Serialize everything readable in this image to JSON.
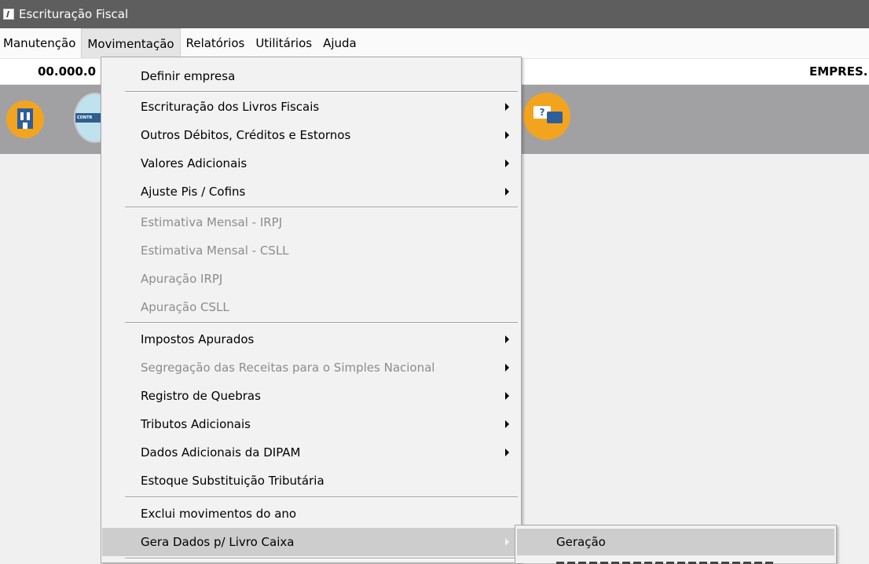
{
  "window": {
    "title": "Escrituração Fiscal",
    "icon": "app-icon"
  },
  "menubar": {
    "items": [
      {
        "label": "Manutenção"
      },
      {
        "label": "Movimentação",
        "active": true
      },
      {
        "label": "Relatórios"
      },
      {
        "label": "Utilitários"
      },
      {
        "label": "Ajuda"
      }
    ]
  },
  "infobar": {
    "left_text": "00.000.0",
    "right_text": "EMPRES."
  },
  "toolbar": {
    "icons": [
      "building-icon",
      "control-icon",
      "help-chat-icon"
    ],
    "control_label": "CONTR",
    "help_mark": "?"
  },
  "dropdown": {
    "items": [
      {
        "label": "Definir empresa",
        "enabled": true,
        "submenu": false
      },
      {
        "label": "Escrituração dos Livros Fiscais",
        "enabled": true,
        "submenu": true
      },
      {
        "label": "Outros Débitos, Créditos e Estornos",
        "enabled": true,
        "submenu": true
      },
      {
        "label": "Valores Adicionais",
        "enabled": true,
        "submenu": true
      },
      {
        "label": "Ajuste Pis / Cofins",
        "enabled": true,
        "submenu": true
      },
      {
        "label": "Estimativa Mensal - IRPJ",
        "enabled": false,
        "submenu": false
      },
      {
        "label": "Estimativa Mensal - CSLL",
        "enabled": false,
        "submenu": false
      },
      {
        "label": "Apuração IRPJ",
        "enabled": false,
        "submenu": false
      },
      {
        "label": "Apuração CSLL",
        "enabled": false,
        "submenu": false
      },
      {
        "label": "Impostos Apurados",
        "enabled": true,
        "submenu": true
      },
      {
        "label": "Segregação das Receitas para o Simples Nacional",
        "enabled": false,
        "submenu": true
      },
      {
        "label": "Registro de Quebras",
        "enabled": true,
        "submenu": true
      },
      {
        "label": "Tributos Adicionais",
        "enabled": true,
        "submenu": true
      },
      {
        "label": "Dados Adicionais da DIPAM",
        "enabled": true,
        "submenu": true
      },
      {
        "label": "Estoque Substituição Tributária",
        "enabled": true,
        "submenu": false
      },
      {
        "label": "Exclui movimentos do ano",
        "enabled": true,
        "submenu": false
      },
      {
        "label": "Gera Dados p/ Livro Caixa",
        "enabled": true,
        "submenu": true,
        "highlighted": true
      }
    ]
  },
  "submenu": {
    "items": [
      {
        "label": "Geração",
        "highlighted": true
      }
    ]
  },
  "colors": {
    "titlebar": "#5e5e5e",
    "toolbar": "#a1a1a3",
    "icon_orange": "#f3a41f",
    "highlight": "#cdcdcd"
  }
}
